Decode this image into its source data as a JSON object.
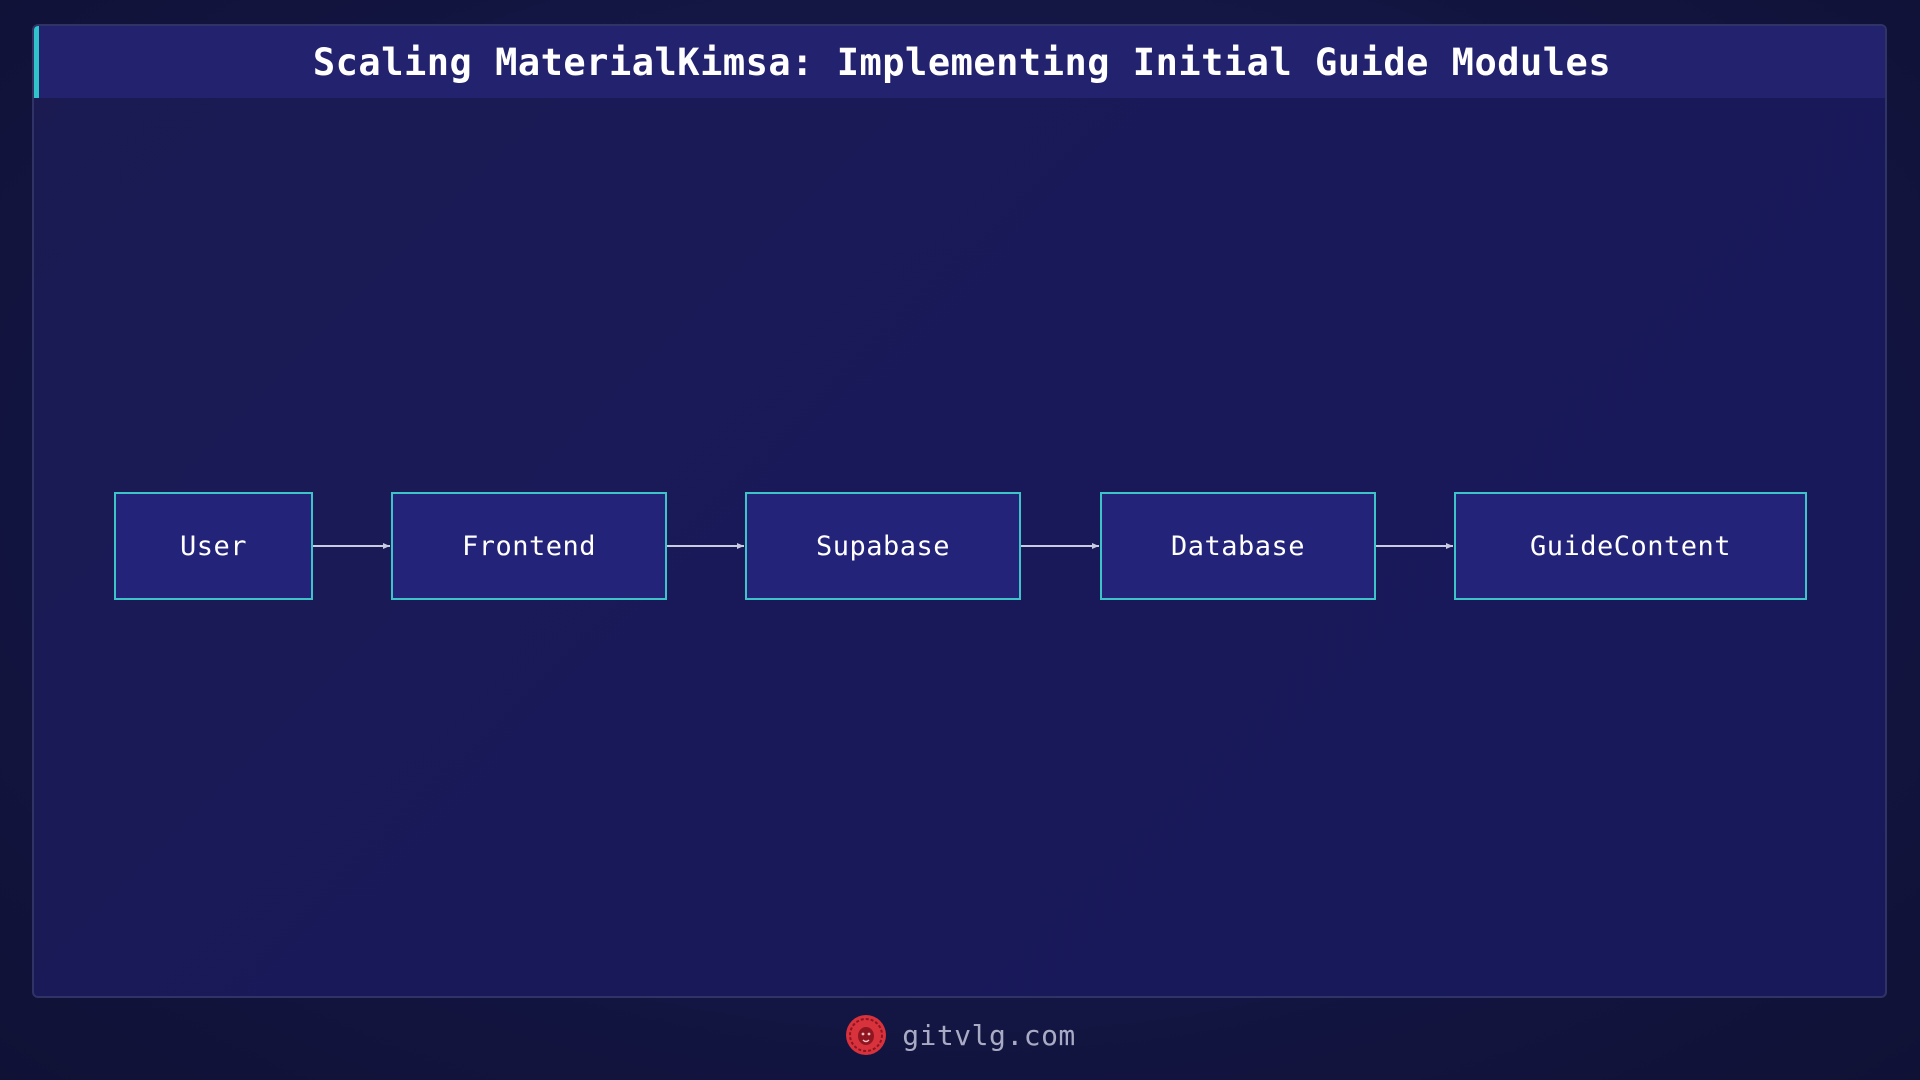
{
  "title": "Scaling MaterialKimsa: Implementing Initial Guide Modules",
  "nodes": [
    {
      "id": "user",
      "label": "User"
    },
    {
      "id": "frontend",
      "label": "Frontend"
    },
    {
      "id": "supabase",
      "label": "Supabase"
    },
    {
      "id": "database",
      "label": "Database"
    },
    {
      "id": "guidecontent",
      "label": "GuideContent"
    }
  ],
  "edges": [
    {
      "from": "user",
      "to": "frontend"
    },
    {
      "from": "frontend",
      "to": "supabase"
    },
    {
      "from": "supabase",
      "to": "database"
    },
    {
      "from": "database",
      "to": "guidecontent"
    }
  ],
  "footer": {
    "site": "gitvlg.com",
    "logo_icon": "lion-logo-icon"
  },
  "colors": {
    "accent": "#2ec4c9",
    "node_fill": "#23237a",
    "node_border": "#3ec3c9",
    "title_bar": "#22226f",
    "arrow": "#c9cbe0",
    "logo": "#d8323c"
  }
}
